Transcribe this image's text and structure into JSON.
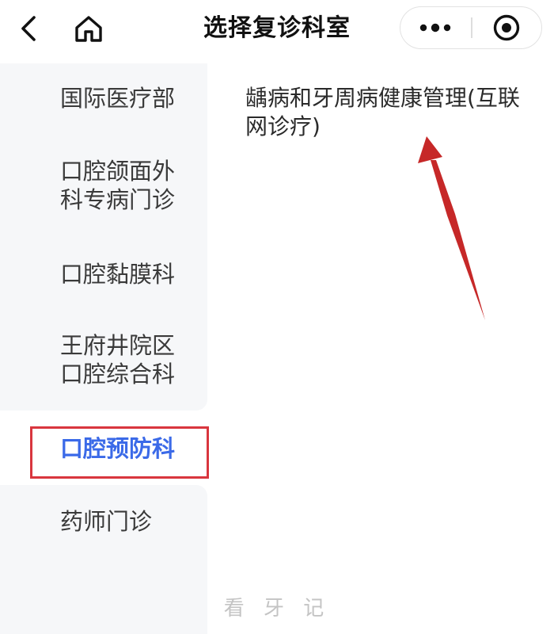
{
  "nav": {
    "title": "选择复诊科室",
    "back_icon": "chevron-left-icon",
    "home_icon": "home-icon",
    "more_icon": "ellipsis-icon",
    "close_icon": "target-circle-icon"
  },
  "sidebar": {
    "items": [
      {
        "label": "国际医疗部",
        "active": false
      },
      {
        "label": "口腔颌面外科专病门诊",
        "active": false
      },
      {
        "label": "口腔黏膜科",
        "active": false
      },
      {
        "label": "王府井院区口腔综合科",
        "active": false
      },
      {
        "label": "口腔预防科",
        "active": true
      },
      {
        "label": "药师门诊",
        "active": false
      }
    ]
  },
  "content": {
    "items": [
      {
        "label": "龋病和牙周病健康管理(互联网诊疗)"
      }
    ]
  },
  "watermark": "看 牙 记",
  "colors": {
    "active_text": "#3b6ae8",
    "sidebar_bg": "#f6f7f9",
    "highlight_border": "#d9363e",
    "annotation_arrow": "#c62828"
  }
}
